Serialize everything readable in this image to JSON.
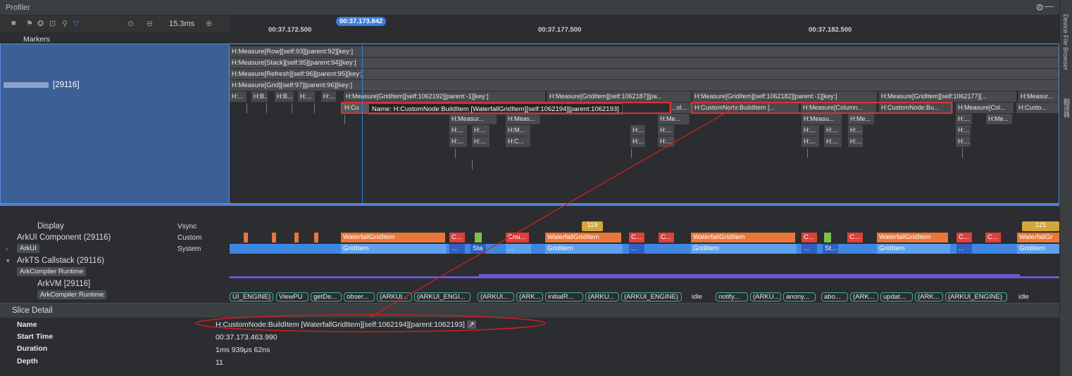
{
  "window": {
    "title": "Profiler"
  },
  "side_tabs": [
    "Device File Browser",
    "翻译器"
  ],
  "toolbar": {
    "zoom": "15.3ms"
  },
  "ruler": {
    "ticks": [
      "00:37.172.500",
      "00:37.177.500",
      "00:37.182.500"
    ],
    "cursor": "00:37.173.842"
  },
  "tracks": {
    "markers": "Markers",
    "process": "[29116]"
  },
  "flame": {
    "rows": [
      "H:Measure[Row][self:93][parent:92][key:]",
      "H:Measure[Stack][self:95][parent:94][key:]",
      "H:Measure[Refresh][self:96][parent:95][key:]",
      "H:Measure[Grid][self:97][parent:96][key:]"
    ],
    "row5": [
      "H:...",
      "H:B...",
      "H:B...",
      "H:...",
      "H:...",
      "H:Measure[GridItem][self:1062192][parent:-1][key:]",
      "H:Measure[GridItem][self:1062187][pa...",
      "H:Measure[GridItem][self:1062182][parent:-1][key:]",
      "H:Measure[GridItem][self:1062177][...",
      "H:Measur..."
    ],
    "row6": [
      "H:Cu",
      "...ol...",
      "H:CustomNode:BuildItem [...",
      "H:Measure[Column...",
      "H:CustomNode:Bu...",
      "H:Measure[Col...",
      "H:Custo..."
    ],
    "row7": [
      "H:Measur...",
      "H:Meas...",
      "H:Measu...",
      "H:Me...",
      "H:...",
      "H:Me...",
      "H:Me..."
    ],
    "row8": [
      "H:...",
      "H:...",
      "H:M...",
      "H:...",
      "H:...",
      "H:...",
      "H:...",
      "H:...",
      "H:..."
    ],
    "row9": [
      "H:...",
      "H:...",
      "H:C...",
      "H:...",
      "H:...",
      "H:...",
      "H:...",
      "H:...",
      "H:..."
    ],
    "tooltip": "Name: H:CustomNode:BuildItem [WaterfallGridItem][self:1062194][parent:1062193]"
  },
  "lower": {
    "display": "Display",
    "display_type": "Vsync",
    "vsync_values": [
      "119",
      "121"
    ],
    "arkui_component": "ArkUI Component (29116)",
    "arkui_component_type": "Custom",
    "arkui_chip": "ArkUI",
    "arkui_chip_type": "System",
    "arkts_callstack": "ArkTS Callstack (29116)",
    "arkcompiler_chip": "ArkCompiler Runtime",
    "arkvm": "ArkVM [29116]",
    "arkvm_chip": "ArkCompiler Runtime",
    "component_segments": [
      "WaterfallGridItem",
      "C...",
      "Chu...",
      "WaterfallGridItem",
      "C...",
      "C...",
      "WaterfallGridItem",
      "C...",
      "C...",
      "WaterfallGridItem",
      "C...",
      "C...",
      "WaterfallGr"
    ],
    "system_segments": [
      "GridItem",
      "...",
      "Sta",
      "...",
      "GridItem",
      "...",
      "GridItem",
      "...",
      "St...",
      "GridItem",
      "...",
      "GridItem"
    ],
    "vm_pills": [
      "UI_ENGINE)",
      "ViewPU",
      "getDe...",
      "obser...",
      "(ARKUI...",
      "(ARKUI_ENGI...",
      "(ARKUI...",
      "(ARK...",
      "initialR...",
      "(ARKU...",
      "(ARKUI_ENGINE)",
      "idle",
      "notify...",
      "(ARKU...",
      "anony...",
      "abo...",
      "(ARK...",
      "updat...",
      "(ARK...",
      "(ARKUI_ENGINE)",
      "idle"
    ]
  },
  "slice_detail": {
    "header": "Slice Detail",
    "name_label": "Name",
    "name_value": "H:CustomNode:BuildItem [WaterfallGridItem][self:1062194][parent:1062193]",
    "start_label": "Start Time",
    "start_value": "00:37.173.463.990",
    "duration_label": "Duration",
    "duration_value": "1ms 939μs 62ns",
    "depth_label": "Depth",
    "depth_value": "11"
  },
  "colors": {
    "accent": "#3b7ddd",
    "highlight": "#e03030",
    "component": "#e8773a",
    "system": "#3f86e0",
    "vsync": "#d4a53a"
  }
}
